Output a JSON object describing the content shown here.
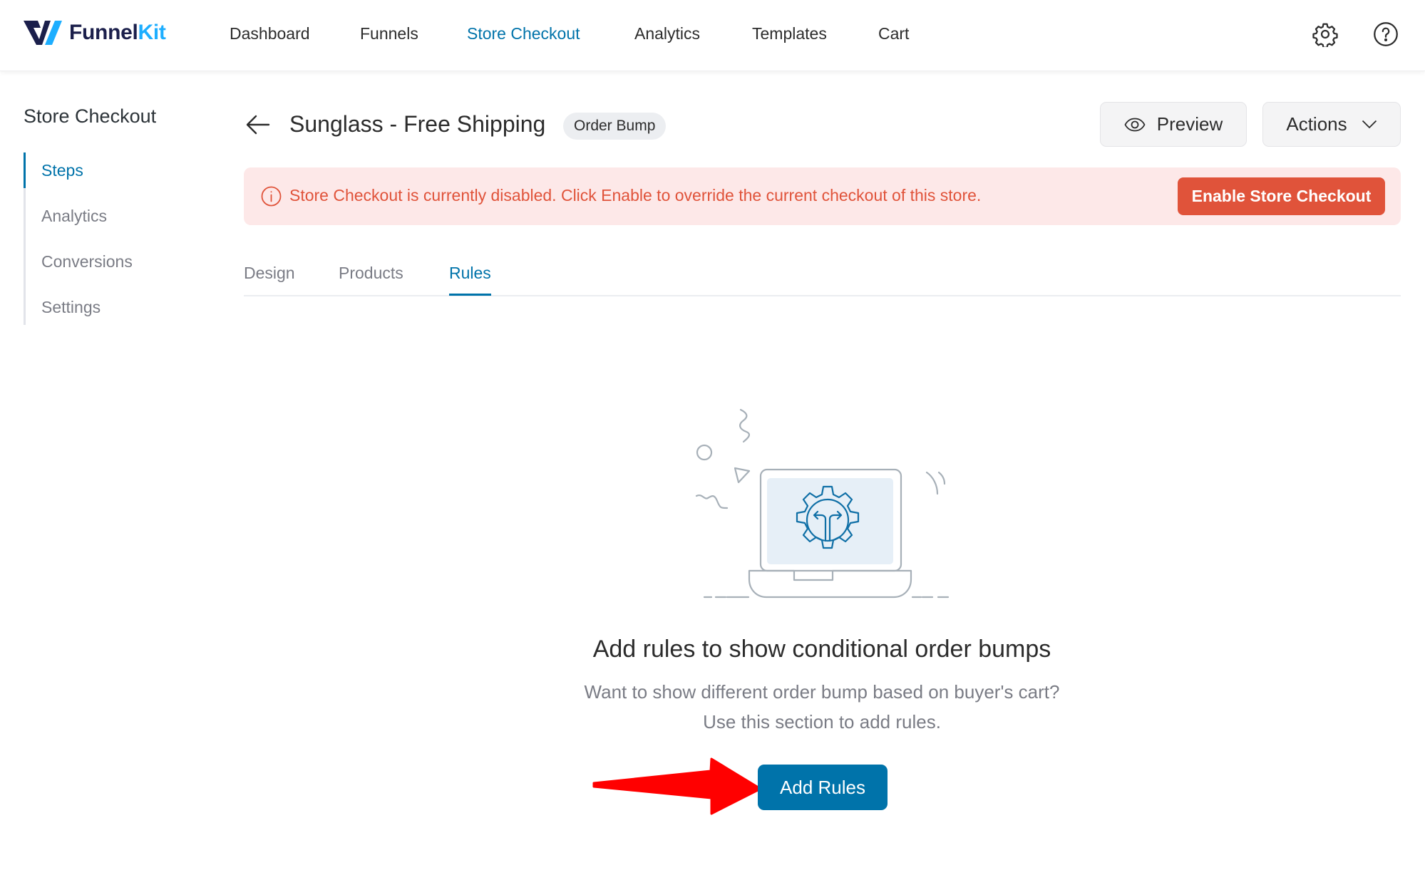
{
  "brand": {
    "name_part1": "Funnel",
    "name_part2": "Kit",
    "primary_color": "#1b1f4b",
    "accent_color": "#1daeff"
  },
  "topnav": {
    "items": [
      {
        "label": "Dashboard",
        "active": false
      },
      {
        "label": "Funnels",
        "active": false
      },
      {
        "label": "Store Checkout",
        "active": true
      },
      {
        "label": "Analytics",
        "active": false
      },
      {
        "label": "Templates",
        "active": false
      },
      {
        "label": "Cart",
        "active": false
      }
    ],
    "icons": [
      "gear-icon",
      "help-icon"
    ]
  },
  "sidebar": {
    "title": "Store Checkout",
    "items": [
      {
        "label": "Steps",
        "active": true
      },
      {
        "label": "Analytics",
        "active": false
      },
      {
        "label": "Conversions",
        "active": false
      },
      {
        "label": "Settings",
        "active": false
      }
    ]
  },
  "page": {
    "title": "Sunglass - Free Shipping",
    "badge": "Order Bump",
    "preview_label": "Preview",
    "actions_label": "Actions"
  },
  "banner": {
    "message": "Store Checkout is currently disabled. Click Enable to override the current checkout of this store.",
    "button_label": "Enable Store Checkout",
    "color": "#e0533a",
    "background": "#fde8e8"
  },
  "tabs": [
    {
      "label": "Design",
      "active": false
    },
    {
      "label": "Products",
      "active": false
    },
    {
      "label": "Rules",
      "active": true
    }
  ],
  "empty_state": {
    "title": "Add rules to show conditional order bumps",
    "description_line1": "Want to show different order bump based on buyer's cart?",
    "description_line2": "Use this section to add rules.",
    "button_label": "Add Rules",
    "button_color": "#0073aa"
  },
  "annotation": {
    "type": "red-arrow",
    "points_to": "Add Rules",
    "color": "#ff0000"
  }
}
